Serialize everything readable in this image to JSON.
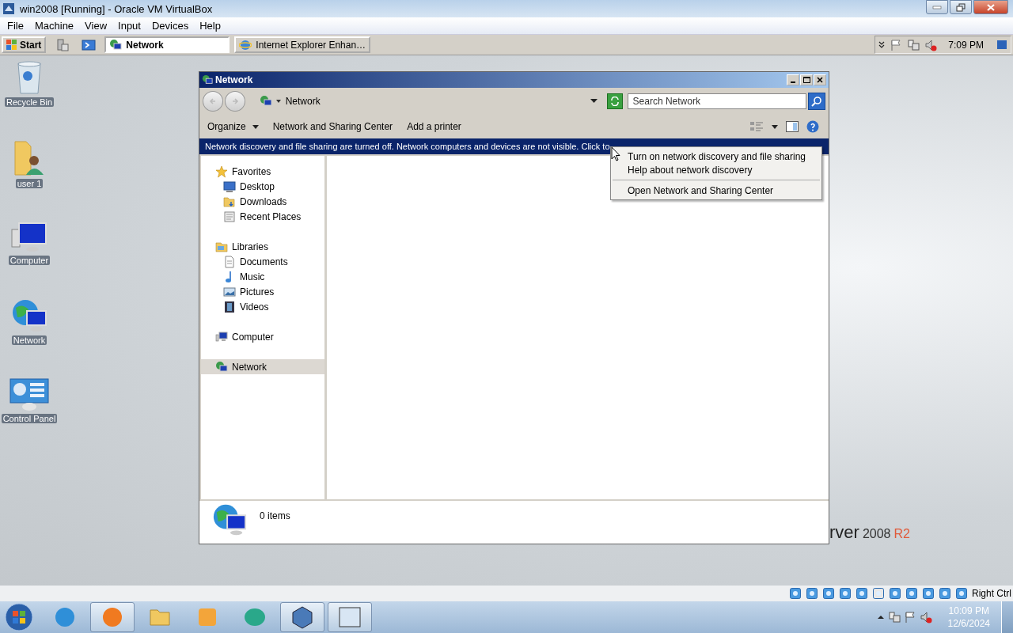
{
  "vbox": {
    "title": "win2008 [Running] - Oracle VM VirtualBox",
    "menu": [
      "File",
      "Machine",
      "View",
      "Input",
      "Devices",
      "Help"
    ],
    "host_key": "Right Ctrl"
  },
  "guest_taskbar": {
    "start": "Start",
    "tasks": [
      {
        "label": "Network",
        "kind": "network",
        "selected": true
      },
      {
        "label": "Internet Explorer Enhan…",
        "kind": "ie",
        "selected": false
      }
    ],
    "clock": "7:09 PM"
  },
  "desktop_icons": [
    {
      "label": "Recycle Bin",
      "kind": "bin"
    },
    {
      "label": "user 1",
      "kind": "userfolder"
    },
    {
      "label": "Computer",
      "kind": "computer"
    },
    {
      "label": "Network",
      "kind": "network"
    },
    {
      "label": "Control Panel",
      "kind": "panel"
    }
  ],
  "explorer": {
    "title": "Network",
    "address": "Network",
    "search": {
      "placeholder": "Search Network"
    },
    "toolbar": [
      {
        "label": "Organize",
        "dropdown": true
      },
      {
        "label": "Network and Sharing Center",
        "dropdown": false
      },
      {
        "label": "Add a printer",
        "dropdown": false
      }
    ],
    "infobar": "Network discovery and file sharing are turned off. Network computers and devices are not visible. Click to",
    "nav": [
      {
        "label": "Favorites",
        "kind": "star",
        "selected": false,
        "children": [
          {
            "label": "Desktop",
            "kind": "desktop",
            "selected": false
          },
          {
            "label": "Downloads",
            "kind": "folder",
            "selected": false
          },
          {
            "label": "Recent Places",
            "kind": "recent",
            "selected": false
          }
        ]
      },
      {
        "label": "Libraries",
        "kind": "library",
        "selected": false,
        "children": [
          {
            "label": "Documents",
            "kind": "doc",
            "selected": false
          },
          {
            "label": "Music",
            "kind": "music",
            "selected": false
          },
          {
            "label": "Pictures",
            "kind": "pictures",
            "selected": false
          },
          {
            "label": "Videos",
            "kind": "video",
            "selected": false
          }
        ]
      },
      {
        "label": "Computer",
        "kind": "computer",
        "selected": false
      },
      {
        "label": "Network",
        "kind": "network",
        "selected": true
      }
    ],
    "status": "0 items"
  },
  "context_menu": {
    "groups": [
      [
        "Turn on network discovery and file sharing",
        "Help about network discovery"
      ],
      [
        "Open Network and Sharing Center"
      ]
    ]
  },
  "branding": {
    "text": "rver",
    "version": "2008",
    "edition": "R2"
  },
  "host_taskbar": {
    "time": "10:09 PM",
    "date": "12/6/2024"
  }
}
